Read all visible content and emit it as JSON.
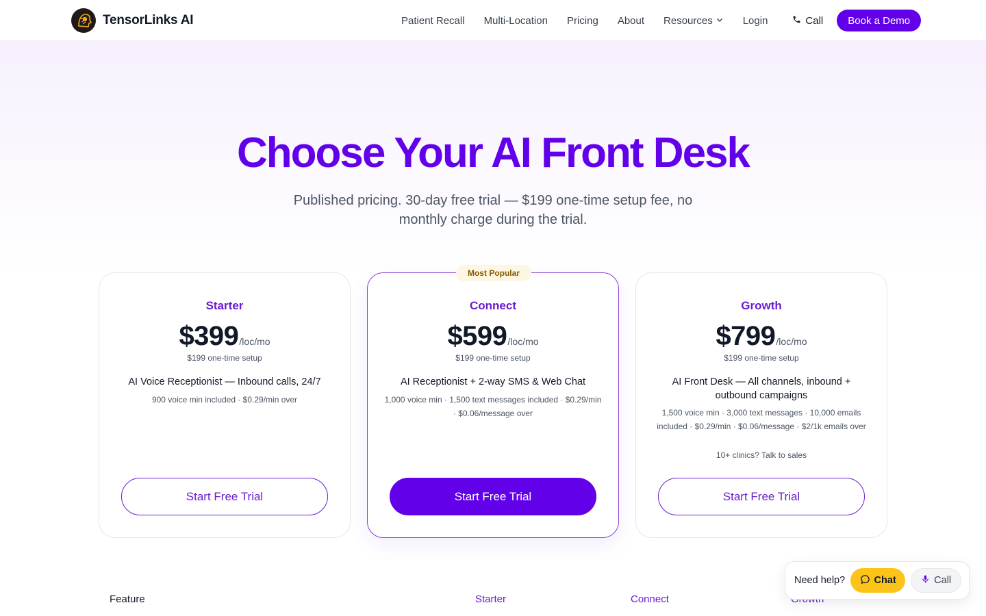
{
  "colors": {
    "accent": "#6200ea",
    "accent_text": "#6a1bd1",
    "badge_bg": "#fdf6e3",
    "help_chat": "#fcc419"
  },
  "nav": {
    "brand": "TensorLinks AI",
    "links": [
      "Patient Recall",
      "Multi-Location",
      "Pricing",
      "About",
      "Resources"
    ],
    "login": "Login",
    "call": "Call",
    "demo": "Book a Demo"
  },
  "hero": {
    "title": "Choose Your AI Front Desk",
    "subtitle": "Published pricing. 30-day free trial — $199 one-time setup fee, no monthly charge during the trial."
  },
  "plans": [
    {
      "name": "Starter",
      "price": "$399",
      "per": "/loc/mo",
      "setup": "$199 one-time setup",
      "tagline": "AI Voice Receptionist — Inbound calls, 24/7",
      "details": "900 voice min included · $0.29/min over",
      "extra": "",
      "cta": "Start Free Trial"
    },
    {
      "badge": "Most Popular",
      "name": "Connect",
      "price": "$599",
      "per": "/loc/mo",
      "setup": "$199 one-time setup",
      "tagline": "AI Receptionist + 2-way SMS & Web Chat",
      "details": "1,000 voice min · 1,500 text messages included · $0.29/min · $0.06/message over",
      "extra": "",
      "cta": "Start Free Trial"
    },
    {
      "name": "Growth",
      "price": "$799",
      "per": "/loc/mo",
      "setup": "$199 one-time setup",
      "tagline": "AI Front Desk — All channels, inbound + outbound campaigns",
      "details": "1,500 voice min · 3,000 text messages · 10,000 emails included · $0.29/min · $0.06/message · $2/1k emails over",
      "extra": "10+ clinics? Talk to sales",
      "cta": "Start Free Trial"
    }
  ],
  "table": {
    "feature": "Feature",
    "starter": "Starter",
    "connect": "Connect",
    "growth": "Growth"
  },
  "help": {
    "text": "Need help?",
    "chat": "Chat",
    "call": "Call"
  }
}
